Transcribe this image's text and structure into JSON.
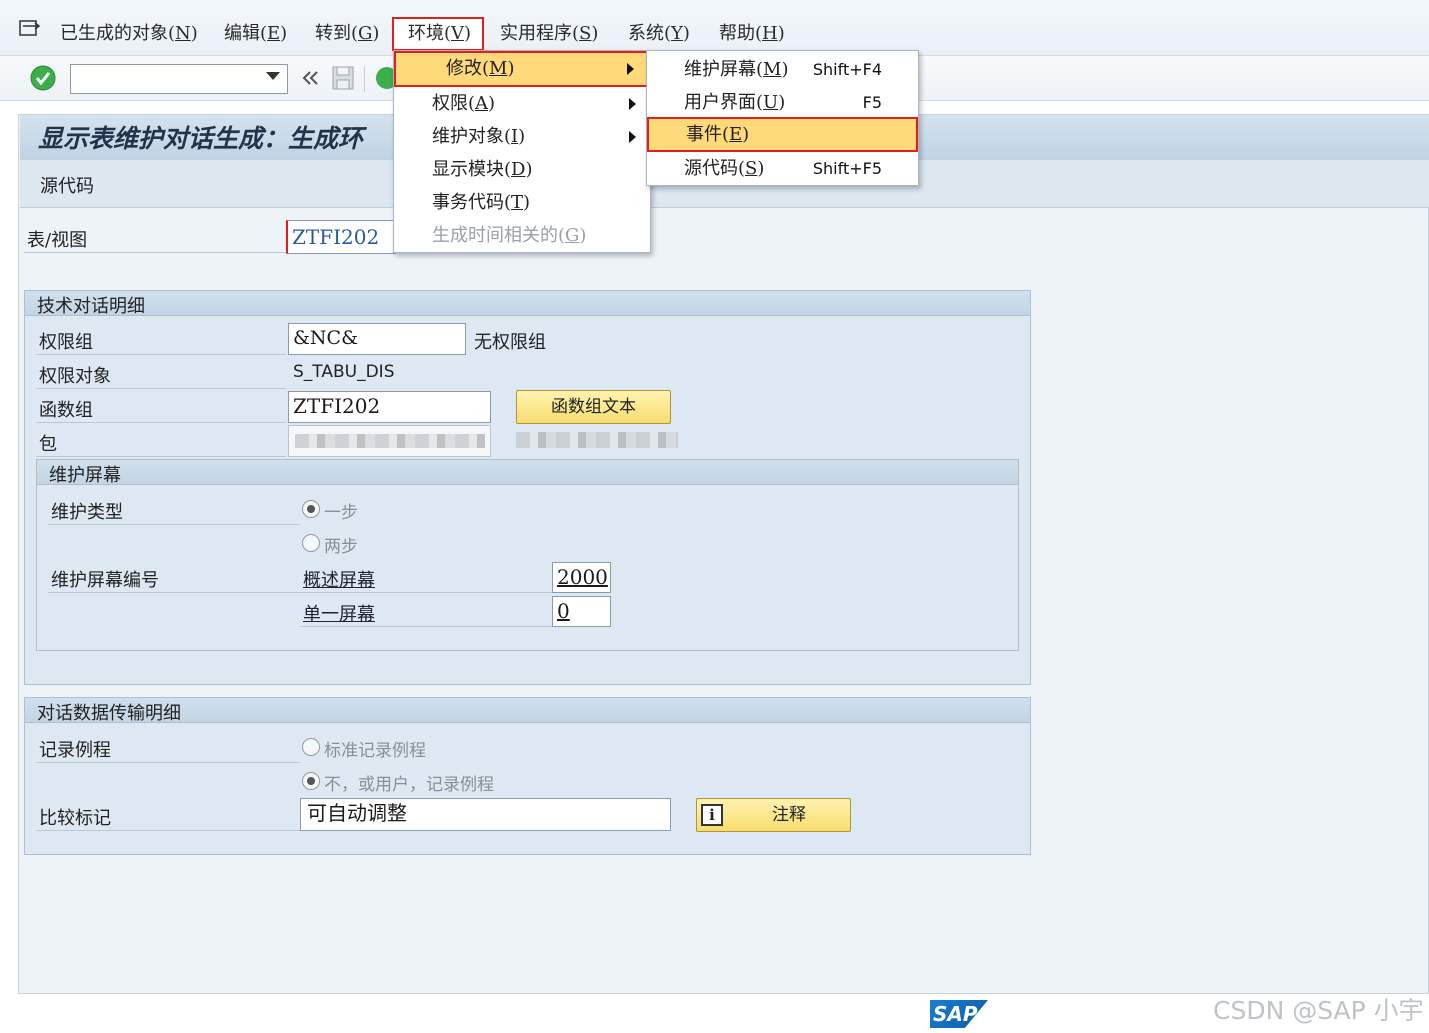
{
  "menubar": {
    "items": [
      {
        "label": "已生成的对象(",
        "key": "N",
        "tail": ")"
      },
      {
        "label": "编辑(",
        "key": "E",
        "tail": ")"
      },
      {
        "label": "转到(",
        "key": "G",
        "tail": ")"
      },
      {
        "label": "环境(",
        "key": "V",
        "tail": ")"
      },
      {
        "label": "实用程序(",
        "key": "S",
        "tail": ")"
      },
      {
        "label": "系统(",
        "key": "Y",
        "tail": ")"
      },
      {
        "label": "帮助(",
        "key": "H",
        "tail": ")"
      }
    ]
  },
  "toolbar": {
    "command_value": ""
  },
  "page": {
    "title": "显示表维护对话生成：生成环",
    "source_code_button": "源代码"
  },
  "table_view": {
    "label": "表/视图",
    "value": "ZTFI202"
  },
  "tech_details": {
    "title": "技术对话明细",
    "auth_group_label": "权限组",
    "auth_group_value": "&NC&",
    "auth_group_text": "无权限组",
    "auth_object_label": "权限对象",
    "auth_object_value": "S_TABU_DIS",
    "function_group_label": "函数组",
    "function_group_value": "ZTFI202",
    "function_group_text_button": "函数组文本",
    "package_label": "包"
  },
  "maint_screen": {
    "title": "维护屏幕",
    "type_label": "维护类型",
    "option_one_step": "一步",
    "option_two_step": "两步",
    "screen_no_label": "维护屏幕编号",
    "overview_link": "概述屏幕",
    "overview_value": "2000",
    "single_link": "单一屏幕",
    "single_value": "0"
  },
  "data_transfer": {
    "title": "对话数据传输明细",
    "record_routine_label": "记录例程",
    "option_standard": "标准记录例程",
    "option_none": "不，或用户，记录例程",
    "compare_flag_label": "比较标记",
    "compare_flag_value": "可自动调整",
    "comment_button": "注释"
  },
  "env_menu": {
    "items": [
      {
        "label": "修改(",
        "key": "M",
        "tail": ")"
      },
      {
        "label": "权限(",
        "key": "A",
        "tail": ")"
      },
      {
        "label": "维护对象(",
        "key": "I",
        "tail": ")"
      },
      {
        "label": "显示模块(",
        "key": "D",
        "tail": ")"
      },
      {
        "label": "事务代码(",
        "key": "T",
        "tail": ")"
      },
      {
        "label": "生成时间相关的(",
        "key": "G",
        "tail": ")"
      }
    ]
  },
  "modify_submenu": {
    "items": [
      {
        "label": "维护屏幕(",
        "key": "M",
        "tail": ")",
        "shortcut": "Shift+F4"
      },
      {
        "label": "用户界面(",
        "key": "U",
        "tail": ")",
        "shortcut": "F5"
      },
      {
        "label": "事件(",
        "key": "E",
        "tail": ")",
        "shortcut": ""
      },
      {
        "label": "源代码(",
        "key": "S",
        "tail": ")",
        "shortcut": "Shift+F5"
      }
    ]
  },
  "branding": {
    "logo_text": "SAP",
    "watermark": "CSDN @SAP 小宇"
  }
}
